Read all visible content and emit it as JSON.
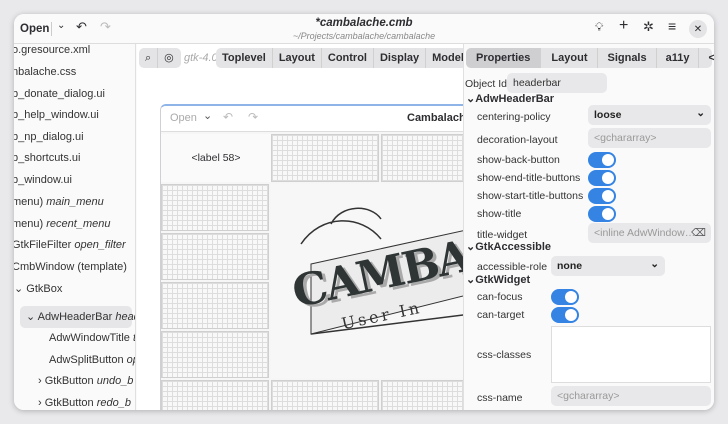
{
  "header": {
    "open": "Open",
    "title": "*cambalache.cmb",
    "subtitle": "~/Projects/cambalache/cambalache"
  },
  "sidebar": {
    "items": [
      {
        "label": "o.gresource.xml"
      },
      {
        "label": "nbalache.css"
      },
      {
        "label": "b_donate_dialog.ui"
      },
      {
        "label": "b_help_window.ui"
      },
      {
        "label": "b_np_dialog.ui"
      },
      {
        "label": "b_shortcuts.ui"
      },
      {
        "label": "b_window.ui"
      },
      {
        "label": "menu)",
        "name": "main_menu"
      },
      {
        "label": "menu)",
        "name": "recent_menu"
      },
      {
        "label": "GtkFileFilter",
        "name": "open_filter"
      },
      {
        "label": "CmbWindow (template)"
      },
      {
        "label": "GtkBox"
      },
      {
        "label": "AdwHeaderBar",
        "name": "heade"
      },
      {
        "label": "AdwWindowTitle",
        "name": "t"
      },
      {
        "label": "AdwSplitButton",
        "name": "op"
      },
      {
        "label": "GtkButton",
        "name": "undo_b"
      },
      {
        "label": "GtkButton",
        "name": "redo_b"
      }
    ]
  },
  "toolbar": {
    "gtk_version": "gtk-4.0",
    "categories": [
      "Toplevel",
      "Layout",
      "Control",
      "Display",
      "Model"
    ]
  },
  "preview": {
    "open": "Open",
    "title": "Cambalache",
    "label": "<label 58>",
    "logo": "CAMBAL",
    "logo_sub": "User In"
  },
  "props": {
    "tabs": [
      "Properties",
      "Layout",
      "Signals",
      "a11y",
      "</>"
    ],
    "object_id_label": "Object Id",
    "object_id": "headerbar",
    "sections": {
      "adw": "AdwHeaderBar",
      "acc": "GtkAccessible",
      "widget": "GtkWidget"
    },
    "centering_policy": {
      "label": "centering-policy",
      "value": "loose"
    },
    "decoration_layout": {
      "label": "decoration-layout",
      "placeholder": "<gchararray>"
    },
    "show_back_button": {
      "label": "show-back-button",
      "on": true
    },
    "show_end": {
      "label": "show-end-title-buttons",
      "on": true
    },
    "show_start": {
      "label": "show-start-title-buttons",
      "on": true
    },
    "show_title": {
      "label": "show-title",
      "on": true
    },
    "title_widget": {
      "label": "title-widget",
      "value": "<inline AdwWindow…"
    },
    "accessible_role": {
      "label": "accessible-role",
      "value": "none"
    },
    "can_focus": {
      "label": "can-focus",
      "on": true
    },
    "can_target": {
      "label": "can-target",
      "on": true
    },
    "css_classes": {
      "label": "css-classes"
    },
    "css_name": {
      "label": "css-name",
      "placeholder": "<gchararray>"
    }
  },
  "colors": {
    "accent": "#3584e4"
  }
}
